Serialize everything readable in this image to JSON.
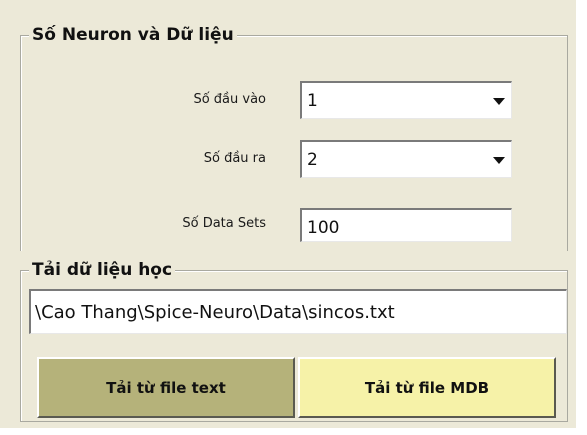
{
  "group_neuron": {
    "title": "Số Neuron và Dữ liệu",
    "inputs_label": "Số đầu vào",
    "inputs_value": "1",
    "outputs_label": "Số đầu ra",
    "outputs_value": "2",
    "datasets_label": "Số Data Sets",
    "datasets_value": "100"
  },
  "group_load": {
    "title": "Tải dữ liệu học",
    "path_value": "\\Cao Thang\\Spice-Neuro\\Data\\sincos.txt",
    "btn_text_label": "Tải từ file text",
    "btn_mdb_label": "Tải từ file MDB"
  },
  "colors": {
    "panel_bg": "#ECE9D8",
    "btn_text_bg": "#B5B27A",
    "btn_mdb_bg": "#F6F2A8"
  }
}
